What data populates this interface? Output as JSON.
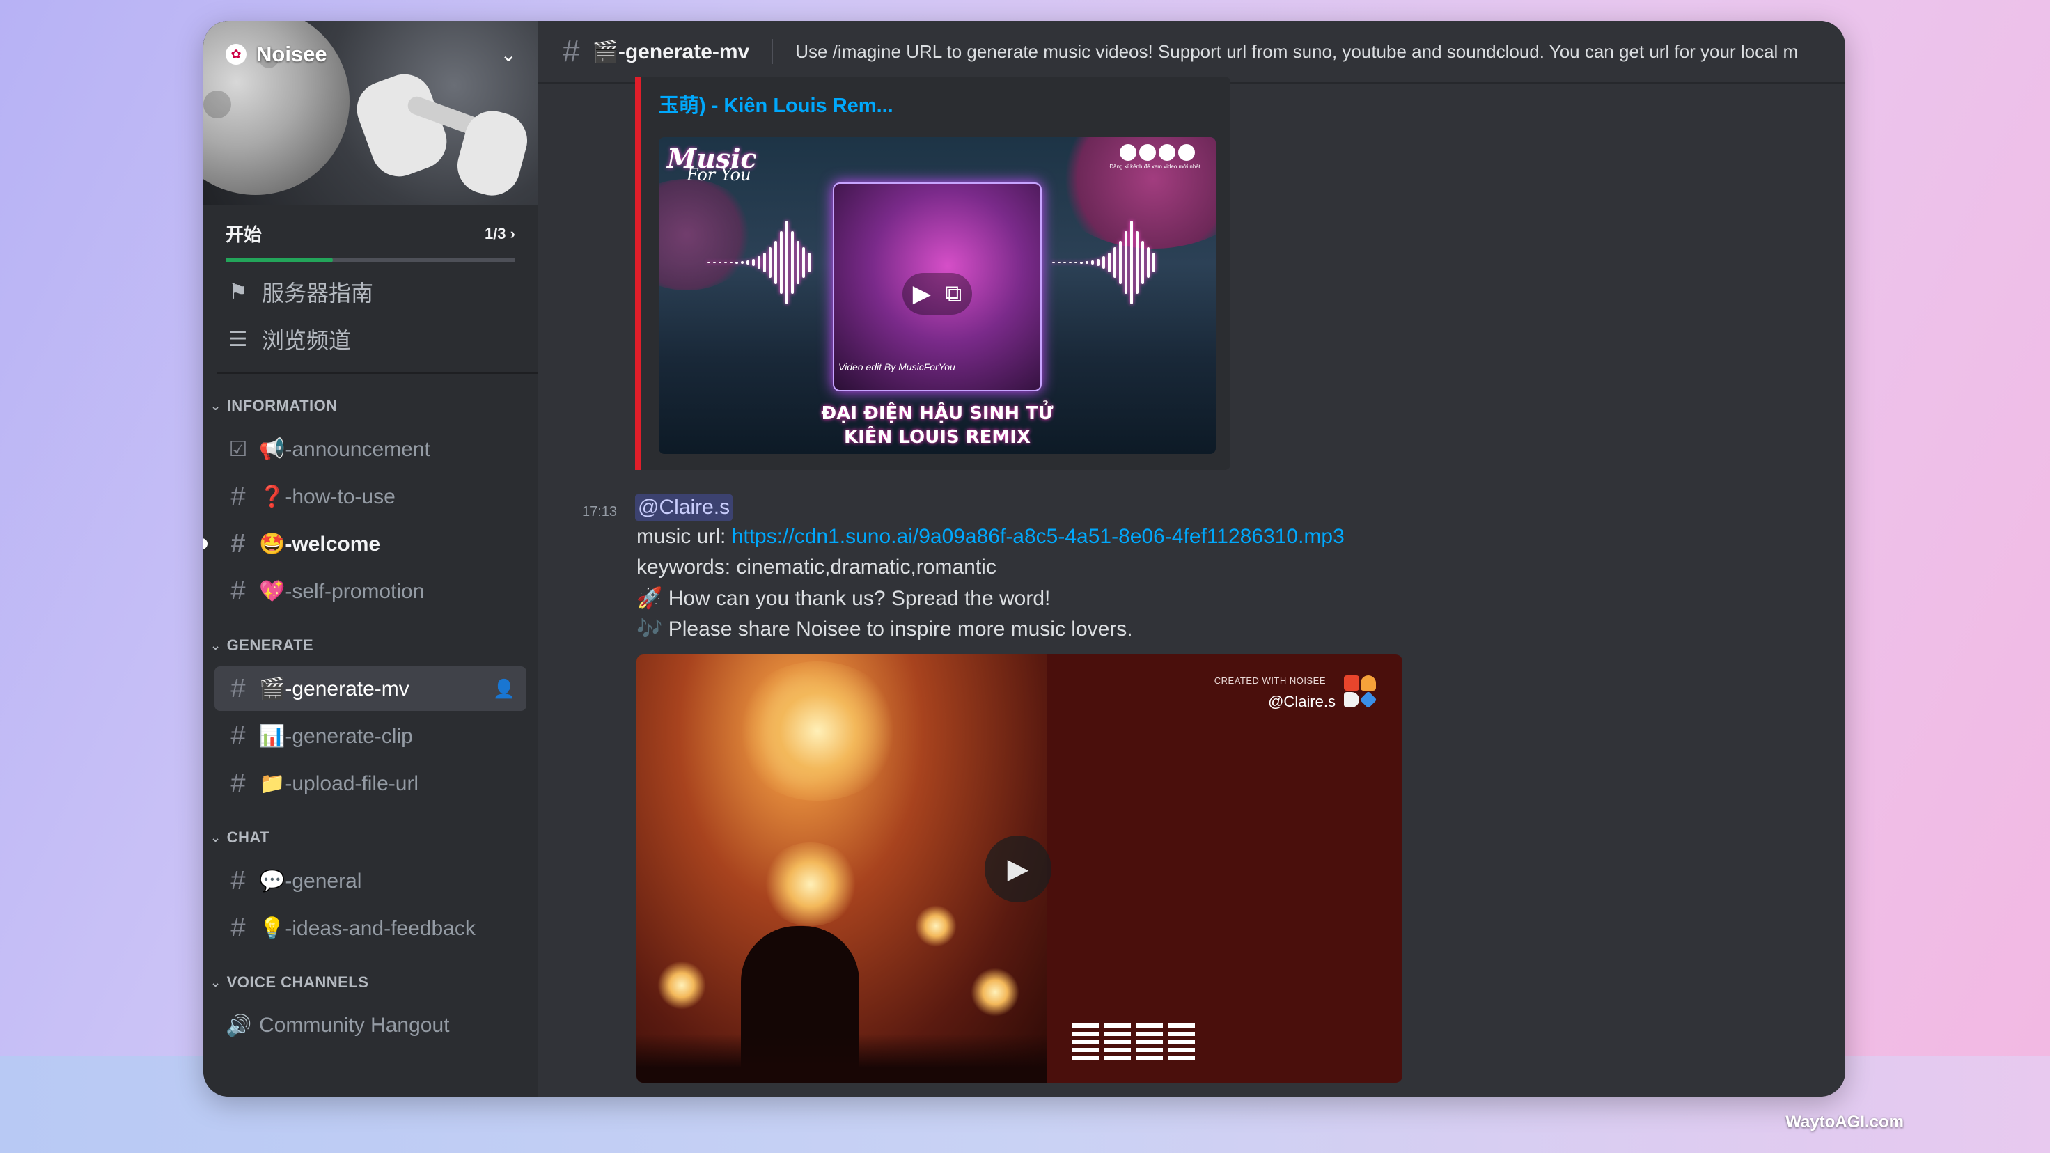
{
  "server": {
    "name": "Noisee"
  },
  "progress": {
    "label": "开始",
    "count": "1/3",
    "value": 0.37
  },
  "nav": [
    {
      "label": "服务器指南",
      "icon": "signpost-icon"
    },
    {
      "label": "浏览频道",
      "icon": "browse-channels-icon"
    }
  ],
  "categories": {
    "information": "INFORMATION",
    "generate": "GENERATE",
    "chat": "CHAT",
    "voice": "VOICE CHANNELS"
  },
  "channels": {
    "announcement": "📢-announcement",
    "how_to_use": "❓-how-to-use",
    "welcome": "🤩-welcome",
    "self_promotion": "💖-self-promotion",
    "generate_mv": "🎬-generate-mv",
    "generate_clip": "📊-generate-clip",
    "upload_file_url": "📁-upload-file-url",
    "general": "💬-general",
    "ideas_and_feedback": "💡-ideas-and-feedback",
    "community_hangout": "Community Hangout"
  },
  "header": {
    "title": "🎬-generate-mv",
    "topic": "Use /imagine URL to generate music videos! Support url from suno, youtube and soundcloud. You can get url for your local m"
  },
  "embed1": {
    "title": "玉萌) - Kiên Louis Rem...",
    "brand_main": "Music",
    "brand_sub": "For You",
    "video_edit": "Video edit By MusicForYou",
    "song_line1": "ĐẠI ĐIỆN HẬU SINH TỬ",
    "song_line2": "KIÊN LOUIS REMIX",
    "social_caption": "Đăng kí kênh để xem video mới nhất"
  },
  "message": {
    "time": "17:13",
    "mention": "@Claire.s",
    "music_url_label": "music url: ",
    "music_url": "https://cdn1.suno.ai/9a09a86f-a8c5-4a51-8e06-4fef11286310.mp3",
    "keywords": "keywords: cinematic,dramatic,romantic",
    "line3_emoji": "🚀",
    "line3": "How can you thank us? Spread the word!",
    "line4_emoji": "🎶",
    "line4": "Please share Noisee to inspire more music lovers."
  },
  "video2": {
    "created_with": "CREATED WITH NOISEE",
    "user": "@Claire.s"
  },
  "watermark": "WaytoAGI.com",
  "colors": {
    "accent_link": "#00a8fc",
    "progress": "#23a55a",
    "embed_border": "#e01e2a",
    "mention_bg": "#3c4270"
  }
}
